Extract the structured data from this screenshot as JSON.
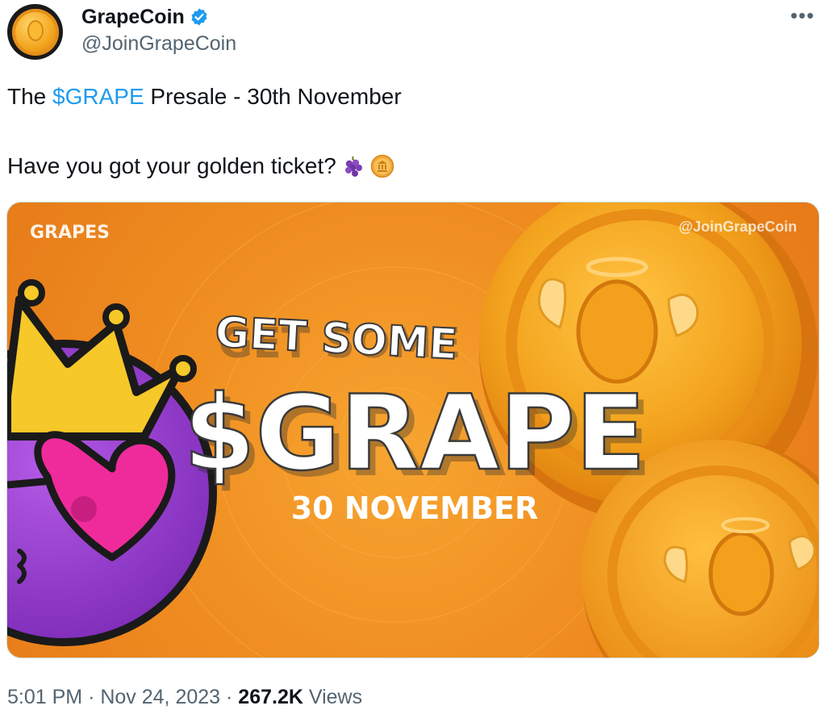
{
  "author": {
    "display_name": "GrapeCoin",
    "handle": "@JoinGrapeCoin",
    "verified": true
  },
  "more_label": "•••",
  "tweet": {
    "line1_prefix": "The ",
    "cashtag": "$GRAPE",
    "line1_suffix": " Presale - 30th November",
    "line2_text": "Have you got your golden ticket?",
    "emojis": [
      "grapes-emoji",
      "coin-emoji"
    ]
  },
  "media": {
    "brand_logo": "GRAPES",
    "watermark": "@JoinGrapeCoin",
    "headline_top": "GET SOME",
    "headline_main": "$GRAPE",
    "date": "30 NOVEMBER"
  },
  "footer": {
    "time": "5:01 PM",
    "date": "Nov 24, 2023",
    "views_count": "267.2K",
    "views_label": "Views",
    "separator": "·"
  },
  "colors": {
    "accent": "#1d9bf0",
    "text": "#0f1419",
    "secondary": "#536471",
    "media_orange": "#f08f22"
  }
}
